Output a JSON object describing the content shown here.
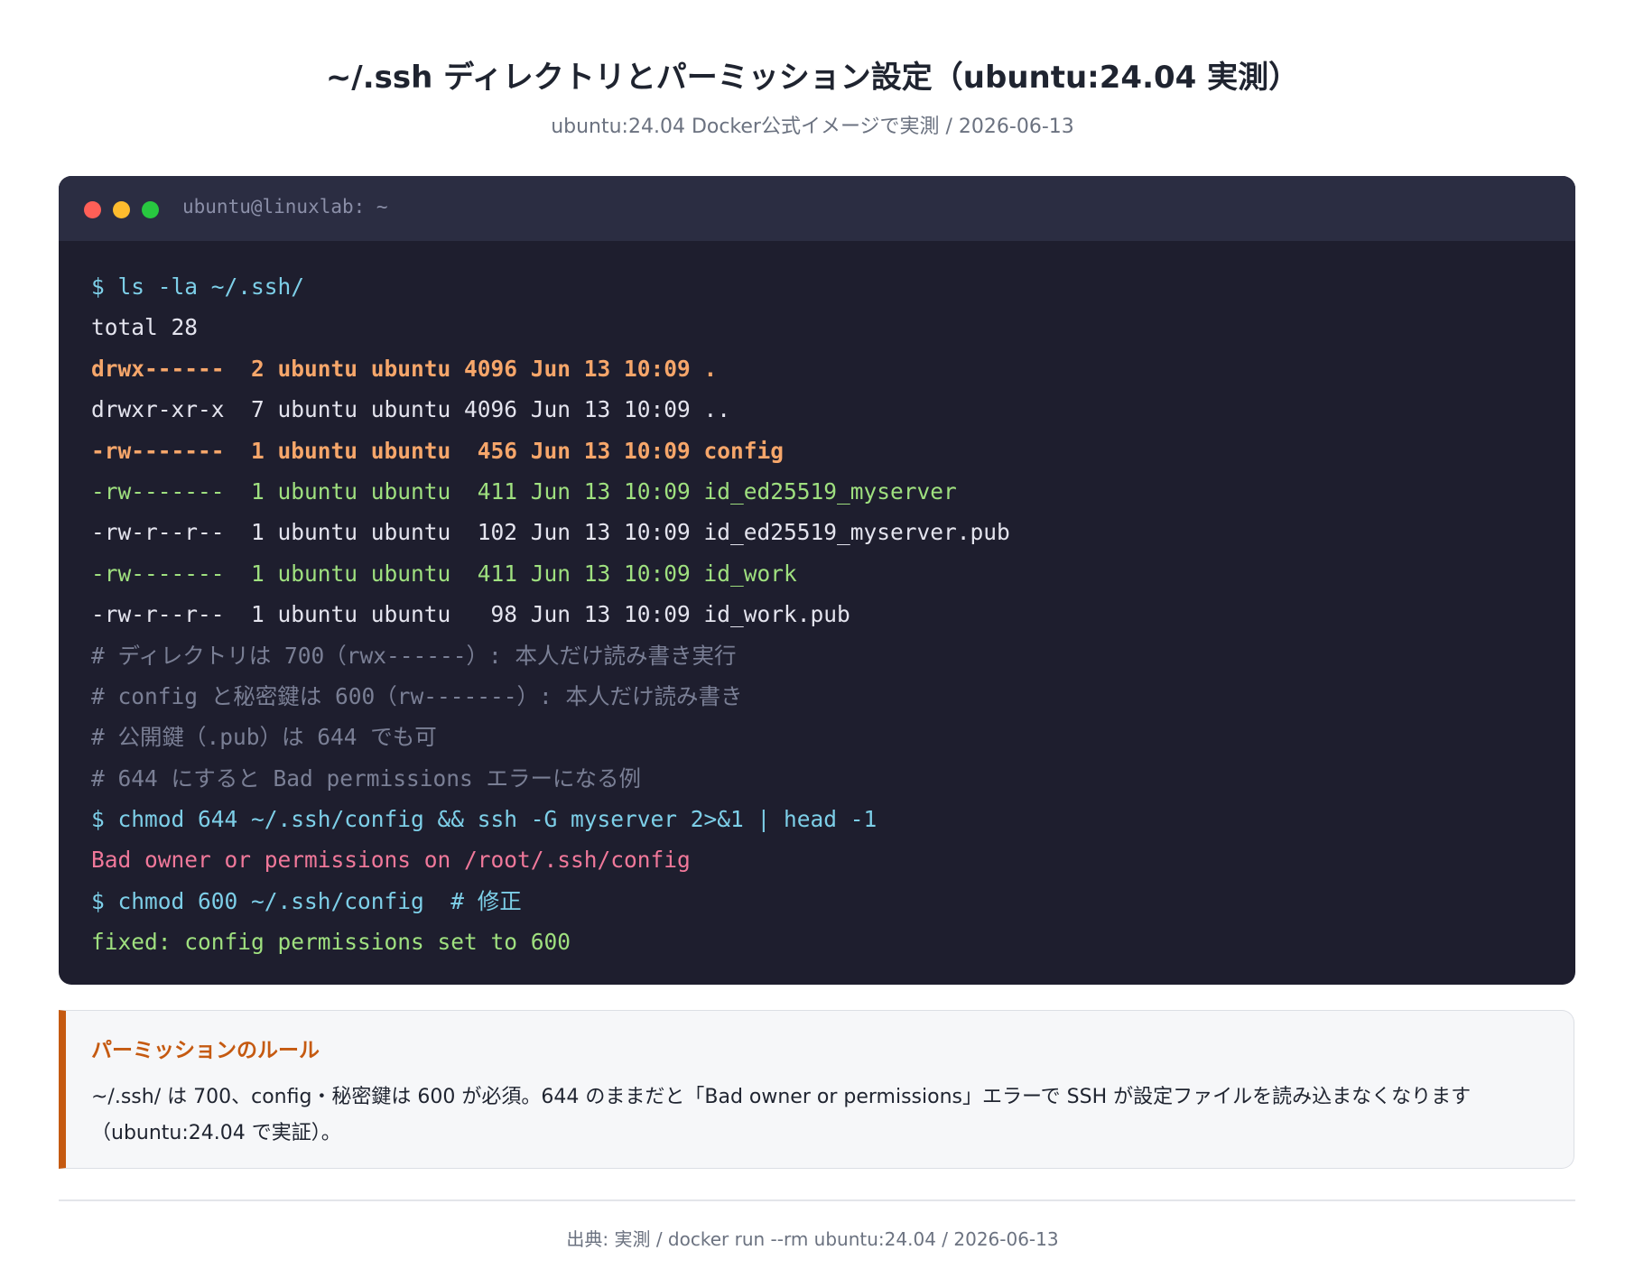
{
  "header": {
    "title": "~/.ssh ディレクトリとパーミッション設定（ubuntu:24.04 実測）",
    "subtitle": "ubuntu:24.04 Docker公式イメージで実測 / 2026-06-13"
  },
  "terminal": {
    "title": "ubuntu@linuxlab: ~",
    "lines": [
      {
        "text": "$ ls -la ~/.ssh/",
        "style": "cmd"
      },
      {
        "text": "total 28",
        "style": "out"
      },
      {
        "text": "drwx------  2 ubuntu ubuntu 4096 Jun 13 10:09 .",
        "style": "orange"
      },
      {
        "text": "drwxr-xr-x  7 ubuntu ubuntu 4096 Jun 13 10:09 ..",
        "style": "out"
      },
      {
        "text": "-rw-------  1 ubuntu ubuntu  456 Jun 13 10:09 config",
        "style": "orange"
      },
      {
        "text": "-rw-------  1 ubuntu ubuntu  411 Jun 13 10:09 id_ed25519_myserver",
        "style": "green"
      },
      {
        "text": "-rw-r--r--  1 ubuntu ubuntu  102 Jun 13 10:09 id_ed25519_myserver.pub",
        "style": "out"
      },
      {
        "text": "-rw-------  1 ubuntu ubuntu  411 Jun 13 10:09 id_work",
        "style": "green"
      },
      {
        "text": "-rw-r--r--  1 ubuntu ubuntu   98 Jun 13 10:09 id_work.pub",
        "style": "out"
      },
      {
        "text": "# ディレクトリは 700（rwx------）: 本人だけ読み書き実行",
        "style": "comment"
      },
      {
        "text": "# config と秘密鍵は 600（rw-------）: 本人だけ読み書き",
        "style": "comment"
      },
      {
        "text": "# 公開鍵（.pub）は 644 でも可",
        "style": "comment"
      },
      {
        "text": "# 644 にすると Bad permissions エラーになる例",
        "style": "comment"
      },
      {
        "text": "$ chmod 644 ~/.ssh/config && ssh -G myserver 2>&1 | head -1",
        "style": "cmd"
      },
      {
        "text": "Bad owner or permissions on /root/.ssh/config",
        "style": "error"
      },
      {
        "text": "$ chmod 600 ~/.ssh/config  # 修正",
        "style": "cmd"
      },
      {
        "text": "fixed: config permissions set to 600",
        "style": "green"
      }
    ]
  },
  "callout": {
    "title": "パーミッションのルール",
    "text": "~/.ssh/ は 700、config・秘密鍵は 600 が必須。644 のままだと「Bad owner or permissions」エラーで SSH が設定ファイルを読み込まなくなります（ubuntu:24.04 で実証）。"
  },
  "footer": {
    "text": "出典: 実測 / docker run --rm ubuntu:24.04 / 2026-06-13"
  },
  "colors": {
    "terminal_bg": "#1e1e2e",
    "command": "#7dcfe8",
    "highlight": "#f6a66a",
    "success": "#9fe07f",
    "error": "#f0789a",
    "accent": "#c55a11"
  }
}
